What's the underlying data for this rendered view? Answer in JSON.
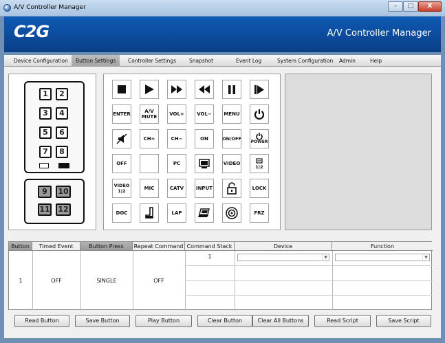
{
  "window": {
    "title": "A/V Controller Manager",
    "close_glyph": "X",
    "min_glyph": "–",
    "max_glyph": "□"
  },
  "banner": {
    "logo": "C2G",
    "title": "A/V Controller Manager",
    "color": "#0d4fa0"
  },
  "menu": {
    "items": [
      "Device Configuration",
      "Button Settings",
      "Controller Settings",
      "Snapshot",
      "Event Log",
      "System Configuration",
      "Admin",
      "Help"
    ],
    "active": "Button Settings"
  },
  "remote": {
    "top_numbers": [
      "1",
      "2",
      "3",
      "4",
      "5",
      "6",
      "7",
      "8"
    ],
    "bottom_numbers": [
      "9",
      "10",
      "11",
      "12"
    ]
  },
  "button_grid": {
    "labels": {
      "enter": "ENTER",
      "av_mute": "A/V MUTE",
      "vol_up": "VOL+",
      "vol_down": "VOL−",
      "menu": "MENU",
      "ch_up": "CH+",
      "ch_down": "CH−",
      "on": "ON",
      "on_off": "ON/OFF",
      "power": "POWER",
      "off": "OFF",
      "pc": "PC",
      "video": "VIDEO",
      "video_12": "VIDEO 1|2",
      "mic": "MIC",
      "catv": "CATV",
      "input": "INPUT",
      "lock": "LOCK",
      "doc": "DOC",
      "lap": "LAP",
      "frz": "FRZ",
      "screen_12": "1|2"
    }
  },
  "table": {
    "headers": [
      "Button",
      "Timed Event",
      "Button Press",
      "Repeat Command",
      "Command Stack",
      "Device",
      "Function"
    ],
    "row": {
      "button": "1",
      "timed_event": "OFF",
      "button_press": "SINGLE",
      "repeat_command": "OFF",
      "command_stack": "1"
    }
  },
  "actions": [
    "Read Button",
    "Save Button",
    "Play Button",
    "Clear Button",
    "Clear All Buttons",
    "Read Script",
    "Save Script"
  ]
}
